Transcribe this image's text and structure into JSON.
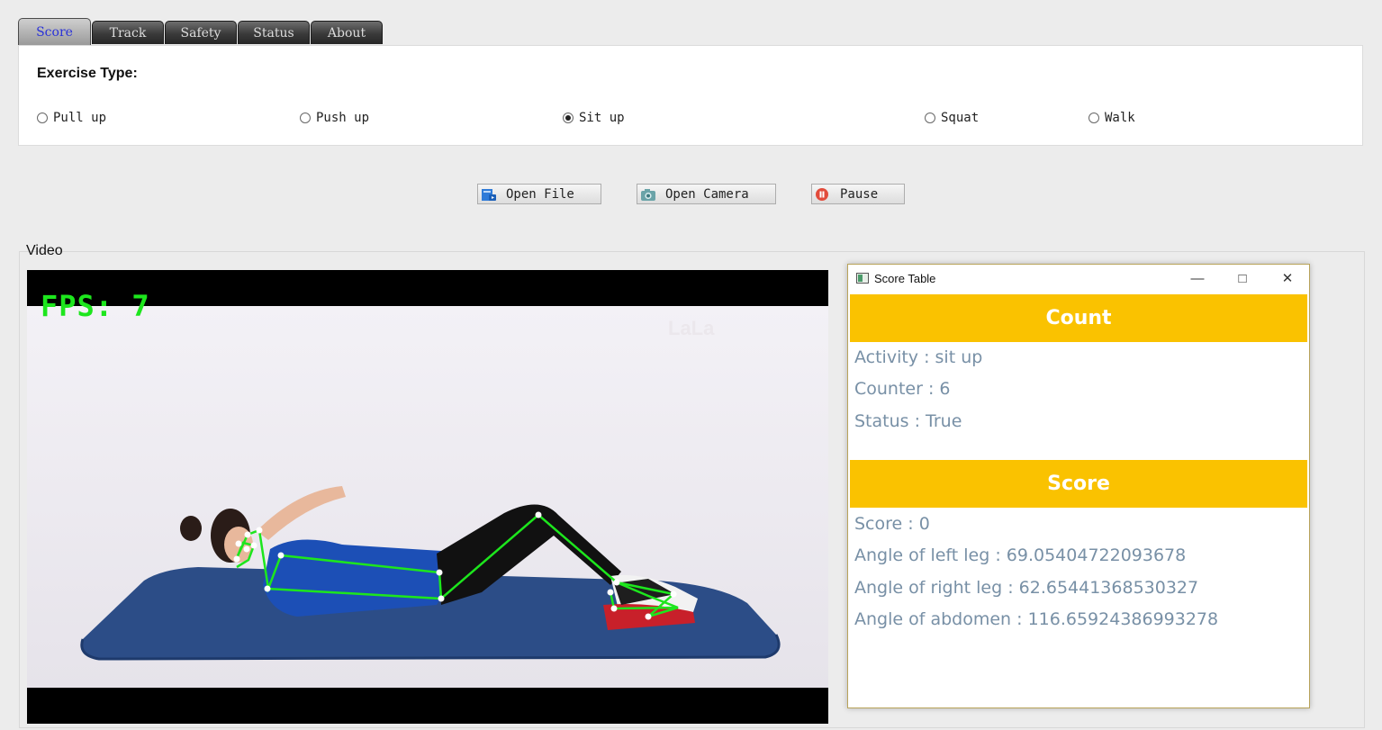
{
  "tabs": [
    {
      "label": "Score",
      "active": true
    },
    {
      "label": "Track",
      "active": false
    },
    {
      "label": "Safety",
      "active": false
    },
    {
      "label": "Status",
      "active": false
    },
    {
      "label": "About",
      "active": false
    }
  ],
  "exercise": {
    "label": "Exercise Type:",
    "options": [
      "Pull up",
      "Push up",
      "Sit up",
      "Squat",
      "Walk"
    ],
    "selected": "Sit up"
  },
  "buttons": {
    "open_file": "Open File",
    "open_camera": "Open Camera",
    "pause": "Pause"
  },
  "video": {
    "label": "Video",
    "fps": "FPS: 7",
    "watermark": "LaLa"
  },
  "score_window": {
    "title": "Score Table",
    "count_header": "Count",
    "activity": "Activity : sit up",
    "counter": "Counter : 6",
    "status": "Status : True",
    "score_header": "Score",
    "score": "Score : 0",
    "angle_left_leg": "Angle of left leg : 69.05404722093678",
    "angle_right_leg": "Angle of right leg : 62.65441368530327",
    "angle_abdomen": "Angle of abdomen : 116.65924386993278"
  },
  "colors": {
    "header_bg": "#fac200",
    "text_blue_gray": "#7890a6",
    "fps_green": "#1de61d",
    "skeleton": "#1de61d",
    "active_tab_text": "#2a32d8"
  }
}
